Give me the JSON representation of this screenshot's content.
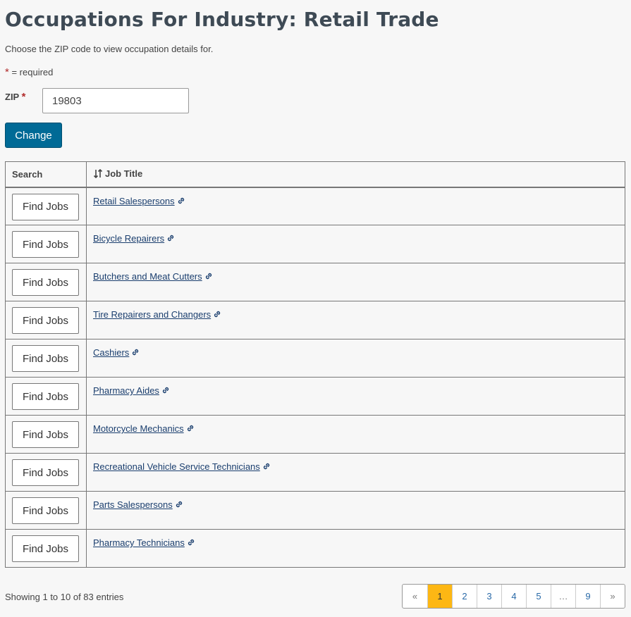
{
  "page_title": "Occupations For Industry: Retail Trade",
  "intro": "Choose the ZIP code to view occupation details for.",
  "required_note": {
    "star": "*",
    "text": "= required"
  },
  "zip_field": {
    "label": "ZIP",
    "star": "*",
    "value": "19803"
  },
  "change_label": "Change",
  "table": {
    "headers": {
      "search": "Search",
      "job_title": "Job Title"
    },
    "find_jobs_label": "Find Jobs",
    "rows": [
      {
        "title": "Retail Salespersons"
      },
      {
        "title": "Bicycle Repairers"
      },
      {
        "title": "Butchers and Meat Cutters"
      },
      {
        "title": "Tire Repairers and Changers"
      },
      {
        "title": "Cashiers"
      },
      {
        "title": "Pharmacy Aides"
      },
      {
        "title": "Motorcycle Mechanics"
      },
      {
        "title": "Recreational Vehicle Service Technicians"
      },
      {
        "title": "Parts Salespersons"
      },
      {
        "title": "Pharmacy Technicians"
      }
    ]
  },
  "showing_text": "Showing 1 to 10 of 83 entries",
  "pagination": {
    "prev": "«",
    "pages": [
      "1",
      "2",
      "3",
      "4",
      "5",
      "…",
      "9"
    ],
    "active_page": "1",
    "next": "»"
  },
  "colors": {
    "heading": "#3e4a55",
    "primary_button": "#006a96",
    "active_page": "#fdb714",
    "link": "#1a3e6e",
    "required_star": "#b12b2b"
  },
  "icons": {
    "sort": "sort-icon",
    "external_link": "link-icon"
  }
}
